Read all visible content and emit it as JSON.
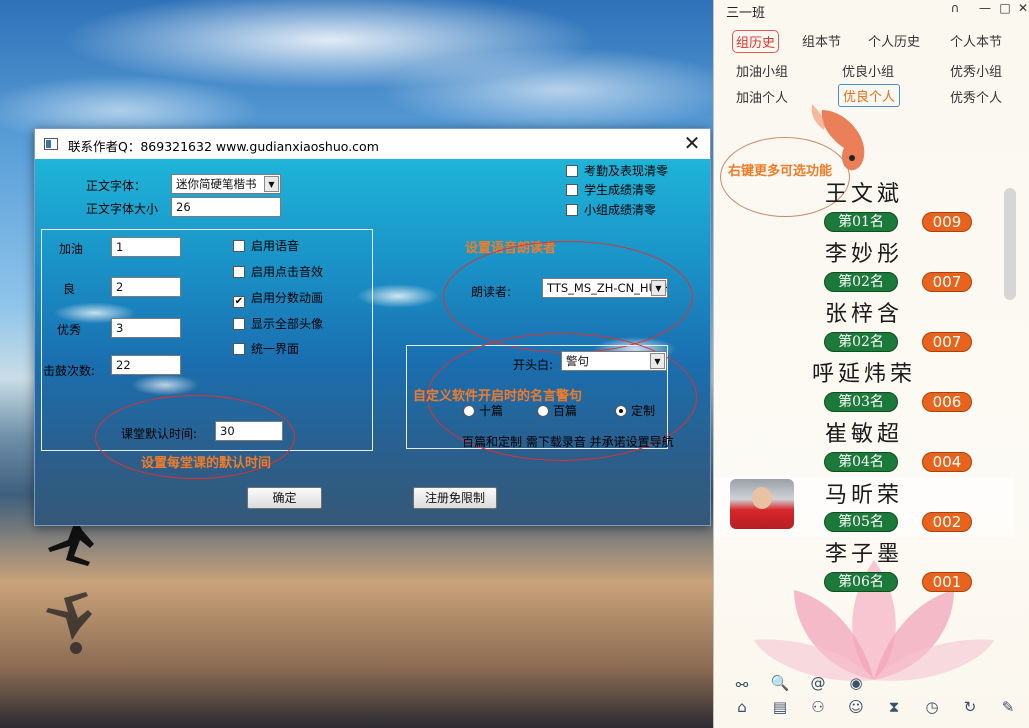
{
  "dialog": {
    "title": "联系作者Q：869321632    www.gudianxiaoshuo.com",
    "close": "✕",
    "font_label": "正文字体：",
    "font_value": "迷你简硬笔楷书",
    "font_size_label": "正文字体大小",
    "font_size_value": "26",
    "checks_top": [
      {
        "label": "考勤及表现清零",
        "checked": false
      },
      {
        "label": "学生成绩清零",
        "checked": false
      },
      {
        "label": "小组成绩清零",
        "checked": false
      }
    ],
    "fields": [
      {
        "label": "加油",
        "value": "1"
      },
      {
        "label": "良",
        "value": "2"
      },
      {
        "label": "优秀",
        "value": "3"
      },
      {
        "label": "击鼓次数:",
        "value": "22"
      }
    ],
    "checks_mid": [
      {
        "label": "启用语音",
        "checked": false
      },
      {
        "label": "启用点击音效",
        "checked": false
      },
      {
        "label": "启用分数动画",
        "checked": true
      },
      {
        "label": "显示全部头像",
        "checked": false
      },
      {
        "label": "统一界面",
        "checked": false
      }
    ],
    "class_time_label": "课堂默认时间:",
    "class_time_value": "30",
    "ann_class_time": "设置每堂课的默认时间",
    "ann_voice": "设置语音朗读者",
    "reader_label": "朗读者:",
    "reader_value": "TTS_MS_ZH-CN_HUIH",
    "opening_label": "开头白:",
    "opening_value": "警句",
    "ann_opening": "自定义软件开启时的名言警句",
    "radios": [
      {
        "label": "十篇",
        "checked": false
      },
      {
        "label": "百篇",
        "checked": false
      },
      {
        "label": "定制",
        "checked": true
      }
    ],
    "note": "百篇和定制 需下载录音 并承诺设置导航",
    "ok_button": "确定",
    "register_button": "注册免限制"
  },
  "panel": {
    "title": "三一班",
    "tabs_row1": [
      "组历史",
      "组本节",
      "个人历史",
      "个人本节"
    ],
    "tabs_row2": [
      "加油小组",
      "优良小组",
      "优秀小组"
    ],
    "tabs_row3": [
      "加油个人",
      "优良个人",
      "优秀个人"
    ],
    "annotation": "右键更多可选功能",
    "students": [
      {
        "name": "王文斌",
        "rank": "第01名",
        "score": "009"
      },
      {
        "name": "李妙彤",
        "rank": "第02名",
        "score": "007"
      },
      {
        "name": "张梓含",
        "rank": "第02名",
        "score": "007"
      },
      {
        "name": "呼延炜荣",
        "rank": "第03名",
        "score": "006"
      },
      {
        "name": "崔敏超",
        "rank": "第04名",
        "score": "004"
      },
      {
        "name": "马昕荣",
        "rank": "第05名",
        "score": "002"
      },
      {
        "name": "李子墨",
        "rank": "第06名",
        "score": "001"
      }
    ],
    "toolbar": [
      {
        "icon": "link-icon",
        "glyph": "⚯"
      },
      {
        "icon": "search-icon",
        "glyph": "🔍"
      },
      {
        "icon": "at-icon",
        "glyph": "@"
      },
      {
        "icon": "eye-icon",
        "glyph": "◉"
      },
      {
        "icon": "home-icon",
        "glyph": "⌂"
      },
      {
        "icon": "document-icon",
        "glyph": "▤"
      },
      {
        "icon": "group-icon",
        "glyph": "⚇"
      },
      {
        "icon": "smile-icon",
        "glyph": "☺"
      },
      {
        "icon": "hourglass-icon",
        "glyph": "⧗"
      },
      {
        "icon": "clock-icon",
        "glyph": "◷"
      },
      {
        "icon": "refresh-icon",
        "glyph": "↻"
      },
      {
        "icon": "wrench-icon",
        "glyph": "✎"
      }
    ]
  }
}
